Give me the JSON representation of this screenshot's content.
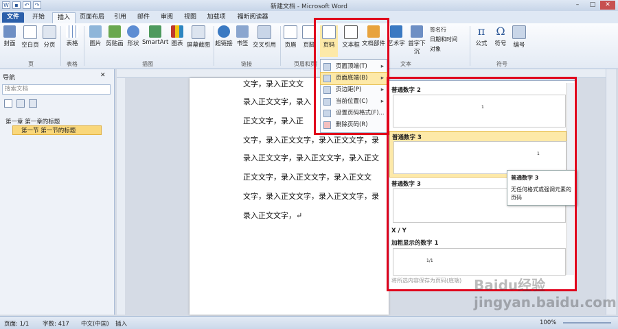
{
  "window": {
    "title": "新建文档 - Microsoft Word"
  },
  "tabs": [
    "文件",
    "开始",
    "插入",
    "页面布局",
    "引用",
    "邮件",
    "审阅",
    "视图",
    "加载项",
    "福昕阅读器"
  ],
  "ribbon": {
    "buttons": [
      "封面",
      "空白页",
      "分页",
      "表格",
      "图片",
      "剪贴画",
      "形状",
      "SmartArt",
      "图表",
      "屏幕截图",
      "超链接",
      "书签",
      "交叉引用",
      "页眉",
      "页脚",
      "页码",
      "文本框",
      "文档部件",
      "艺术字",
      "首字下沉",
      "公式",
      "符号",
      "编号"
    ],
    "small": [
      "签名行",
      "日期和时间",
      "对象"
    ],
    "groups": [
      "页",
      "表格",
      "插图",
      "链接",
      "页眉和页脚",
      "文本",
      "符号"
    ]
  },
  "nav": {
    "title": "导航",
    "search_placeholder": "搜索文档",
    "items": [
      "第一章 第一章的标题",
      "第一节 第一节的标题"
    ]
  },
  "doc": {
    "lines": [
      "文字，录入正文文",
      "录入正文文字，录入",
      "正文文字，录入正",
      "文字，录入正文文字，录入正文文字，录",
      "录入正文文字，录入正文文字，录入正文",
      "正文文字，录入正文文字，录入正文文",
      "文字，录入正文文字，录入正文文字，录",
      "录入正文文字，↵"
    ]
  },
  "menu": {
    "items": [
      "页面顶端(T)",
      "页面底端(B)",
      "页边距(P)",
      "当前位置(C)",
      "设置页码格式(F)...",
      "删除页码(R)"
    ]
  },
  "gallery": {
    "headers": [
      "普通数字 2",
      "普通数字 3",
      "普通数字 3",
      "X / Y",
      "加粗显示的数字 1"
    ],
    "footer": "将所选内容保存为页码(底端)"
  },
  "tooltip": {
    "title": "普通数字 3",
    "body": "无任何格式或强调元素的页码"
  },
  "status": {
    "page": "页面: 1/1",
    "words": "字数: 417",
    "lang": "中文(中国)",
    "mode": "插入",
    "zoom": "100%"
  },
  "watermark": "Baidu经验 jingyan.baidu.com",
  "colors": {
    "accent": "#2b5faa",
    "highlight": "#e0001b",
    "menu_hover": "#fde9a8"
  }
}
